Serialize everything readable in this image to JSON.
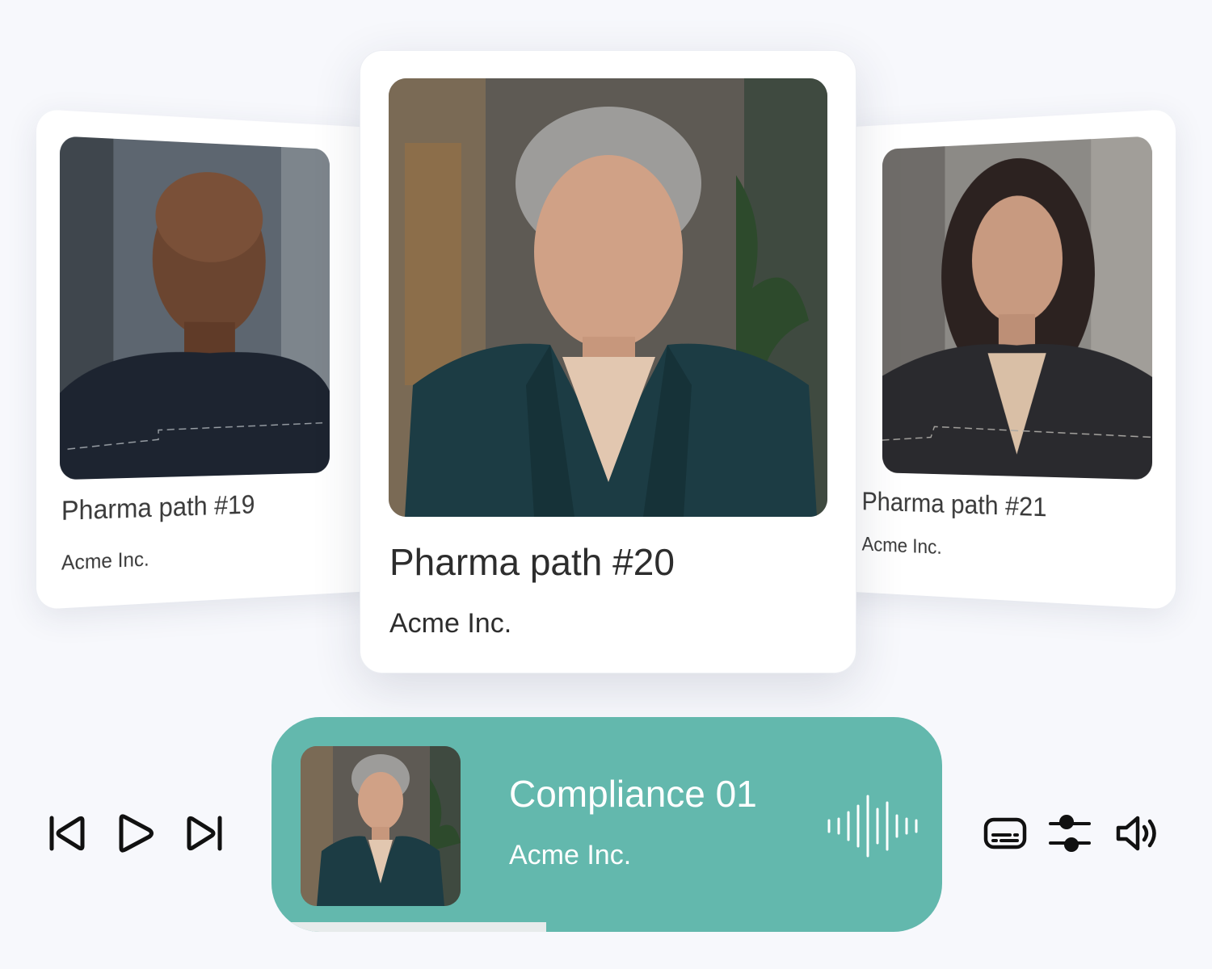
{
  "cards": [
    {
      "id": "left",
      "title": "Pharma path #19",
      "company": "Acme Inc."
    },
    {
      "id": "center",
      "title": "Pharma path #20",
      "company": "Acme Inc."
    },
    {
      "id": "right",
      "title": "Pharma path #21",
      "company": "Acme Inc."
    }
  ],
  "player": {
    "title": "Compliance 01",
    "company": "Acme Inc.",
    "progress": 0.41,
    "accent": "#63b8ad"
  },
  "controls": {
    "left": [
      "skip-back-icon",
      "play-icon",
      "skip-forward-icon"
    ],
    "right": [
      "subtitles-icon",
      "settings-sliders-icon",
      "volume-icon"
    ]
  }
}
